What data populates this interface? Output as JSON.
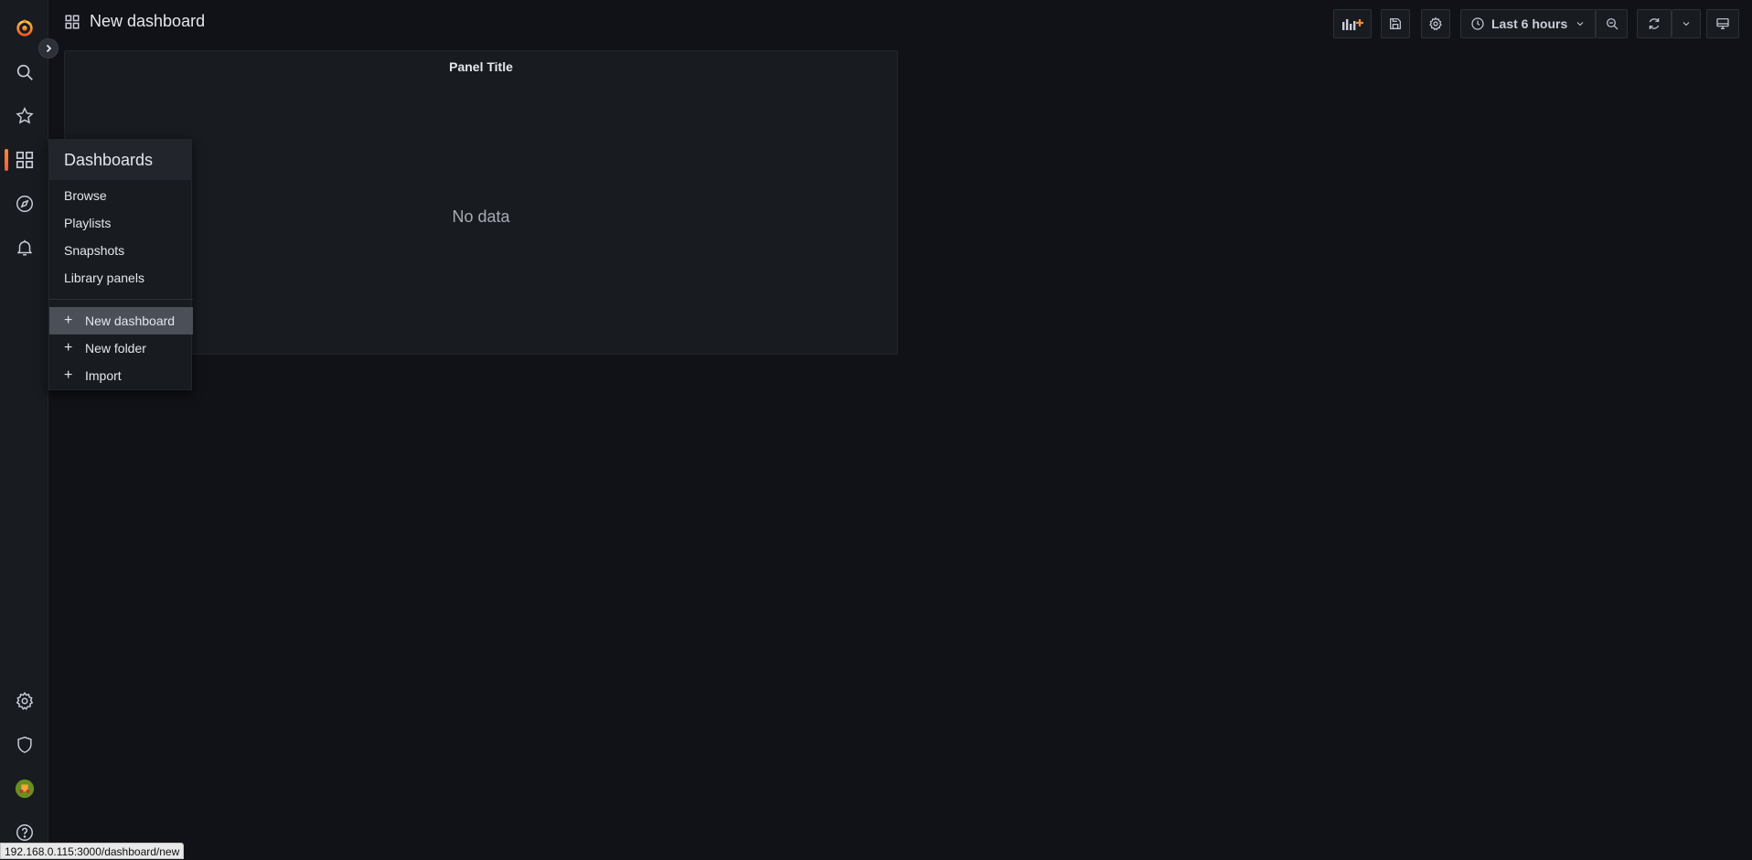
{
  "header": {
    "title": "New dashboard"
  },
  "toolbar": {
    "time_range_label": "Last 6 hours",
    "add_panel_icon": "add-panel-icon",
    "save_icon": "save-icon",
    "settings_icon": "gear-icon",
    "clock_icon": "clock-icon",
    "zoom_out_icon": "zoom-out-icon",
    "refresh_icon": "refresh-icon",
    "tv_icon": "tv-mode-icon"
  },
  "sidebar": {
    "items": [
      {
        "icon": "grafana-logo-icon"
      },
      {
        "icon": "search-icon"
      },
      {
        "icon": "star-icon"
      },
      {
        "icon": "dashboards-icon",
        "active": true
      },
      {
        "icon": "explore-compass-icon"
      },
      {
        "icon": "alerting-bell-icon"
      },
      {
        "icon": "gear-icon"
      },
      {
        "icon": "shield-icon"
      },
      {
        "icon": "avatar"
      },
      {
        "icon": "help-icon"
      }
    ]
  },
  "panel": {
    "title": "Panel Title",
    "empty_text": "No data"
  },
  "dashboards_menu": {
    "title": "Dashboards",
    "links": [
      "Browse",
      "Playlists",
      "Snapshots",
      "Library panels"
    ],
    "actions": [
      "New dashboard",
      "New folder",
      "Import"
    ],
    "highlighted_action": "New dashboard"
  },
  "status_bar": {
    "url": "192.168.0.115:3000/dashboard/new"
  },
  "colors": {
    "background": "#111217",
    "panel": "#181b1f",
    "accent": "#ff8833",
    "highlight": "#4b4f57"
  }
}
